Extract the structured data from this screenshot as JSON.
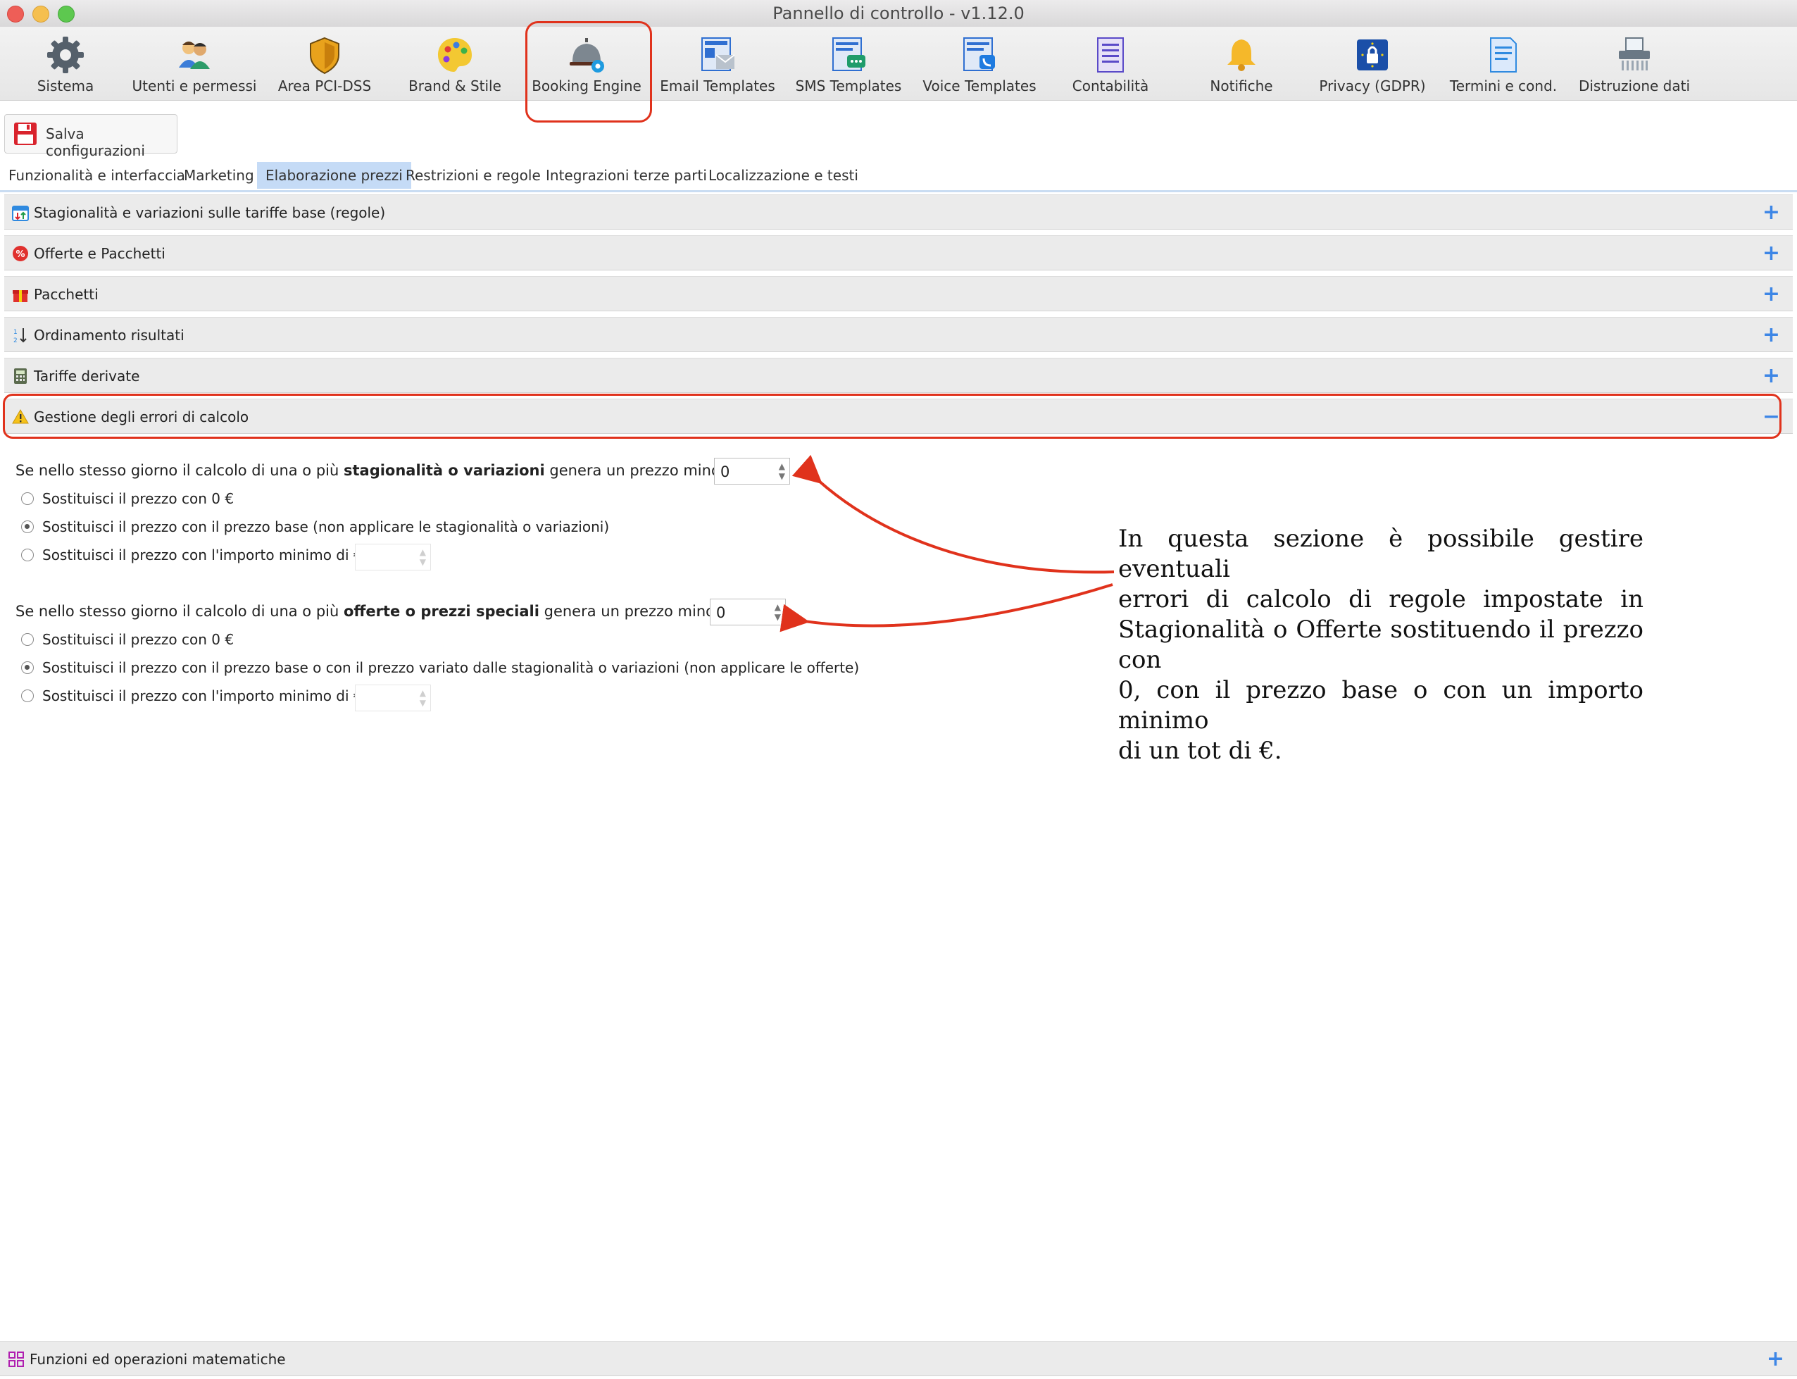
{
  "window": {
    "title": "Pannello di controllo - v1.12.0"
  },
  "toolbar": [
    {
      "label": "Sistema",
      "icon": "gear-icon"
    },
    {
      "label": "Utenti e permessi",
      "icon": "users-icon"
    },
    {
      "label": "Area PCI-DSS",
      "icon": "shield-icon"
    },
    {
      "label": "Brand & Stile",
      "icon": "palette-icon"
    },
    {
      "label": "Booking Engine",
      "icon": "reception-bell-icon"
    },
    {
      "label": "Email Templates",
      "icon": "email-template-icon"
    },
    {
      "label": "SMS Templates",
      "icon": "sms-template-icon"
    },
    {
      "label": "Voice Templates",
      "icon": "voice-template-icon"
    },
    {
      "label": "Contabilità",
      "icon": "ledger-icon"
    },
    {
      "label": "Notifiche",
      "icon": "bell-icon"
    },
    {
      "label": "Privacy (GDPR)",
      "icon": "gdpr-lock-icon"
    },
    {
      "label": "Termini e cond.",
      "icon": "document-icon"
    },
    {
      "label": "Distruzione dati",
      "icon": "shredder-icon"
    }
  ],
  "save_button": {
    "label": "Salva configurazioni",
    "icon": "floppy-icon"
  },
  "tabs": [
    {
      "label": "Funzionalità e interfaccia"
    },
    {
      "label": "Marketing"
    },
    {
      "label": "Elaborazione prezzi"
    },
    {
      "label": "Restrizioni e regole"
    },
    {
      "label": "Integrazioni terze parti"
    },
    {
      "label": "Localizzazione e testi"
    }
  ],
  "accordion": [
    {
      "label": "Stagionalità e variazioni sulle tariffe base (regole)",
      "toggle": "+"
    },
    {
      "label": "Offerte e Pacchetti",
      "toggle": "+"
    },
    {
      "label": "Pacchetti",
      "toggle": "+"
    },
    {
      "label": "Ordinamento risultati",
      "toggle": "+"
    },
    {
      "label": "Tariffe derivate",
      "toggle": "+"
    },
    {
      "label": "Gestione degli errori di calcolo",
      "toggle": "−"
    }
  ],
  "section1": {
    "prefix": "Se nello stesso giorno il calcolo di una o più ",
    "bold": "stagionalità o variazioni",
    "suffix": " genera un prezzo minore di €",
    "value": "0",
    "options": [
      {
        "label": "Sostituisci il prezzo con 0 €",
        "selected": false
      },
      {
        "label": "Sostituisci il prezzo con il prezzo base (non applicare le stagionalità o variazioni)",
        "selected": true
      },
      {
        "label": "Sostituisci il prezzo con l'importo minimo di €",
        "selected": false
      }
    ]
  },
  "section2": {
    "prefix": "Se nello stesso giorno il calcolo di una o più ",
    "bold": "offerte o prezzi speciali",
    "suffix": " genera un prezzo minore di €",
    "value": "0",
    "options": [
      {
        "label": "Sostituisci il prezzo con 0 €",
        "selected": false
      },
      {
        "label": "Sostituisci il prezzo con il prezzo base o con il prezzo variato dalle stagionalità o variazioni (non applicare le offerte)",
        "selected": true
      },
      {
        "label": "Sostituisci il prezzo con l'importo minimo di €",
        "selected": false
      }
    ]
  },
  "annotation": {
    "lines": [
      "In questa sezione è possibile gestire eventuali",
      "errori di calcolo di regole impostate in",
      "Stagionalità o Offerte sostituendo il prezzo con",
      "0, con il prezzo base o con un importo minimo",
      "di un tot di €."
    ],
    "color": "#e0321c"
  },
  "footer_accordion": {
    "label": "Funzioni ed operazioni matematiche",
    "toggle": "+"
  },
  "colors": {
    "accent": "#3d86e6",
    "active_tab": "#c5dbf6",
    "highlight": "#e0321c"
  }
}
